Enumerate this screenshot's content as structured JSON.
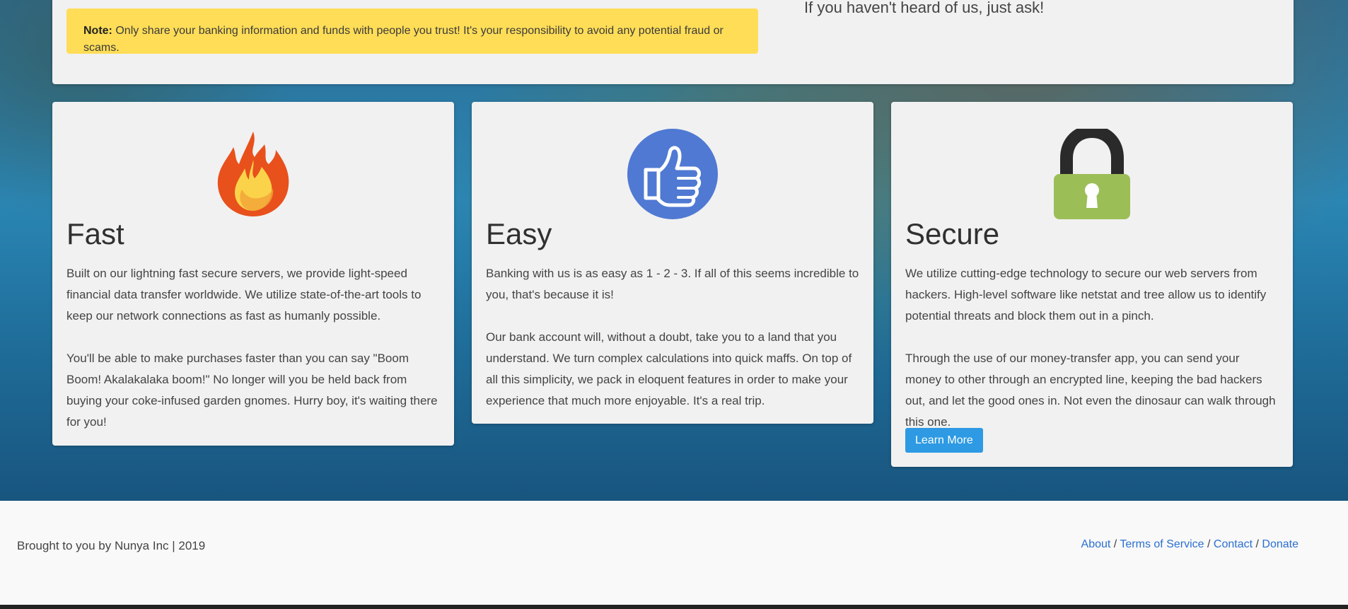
{
  "notice": {
    "label": "Note:",
    "text": "Only share your banking information and funds with people you trust! It's your responsibility to avoid any potential fraud or scams."
  },
  "top_right_text": "If you haven't heard of us, just ask!",
  "cards": [
    {
      "title": "Fast",
      "icon": "fire-icon",
      "paragraphs": [
        "Built on our lightning fast secure servers, we provide light-speed financial data transfer worldwide. We utilize state-of-the-art tools to keep our network connections as fast as humanly possible.",
        "You'll be able to make purchases faster than you can say \"Boom Boom! Akalakalaka boom!\" No longer will you be held back from buying your coke-infused garden gnomes. Hurry boy, it's waiting there for you!"
      ]
    },
    {
      "title": "Easy",
      "icon": "thumbs-up-icon",
      "paragraphs": [
        "Banking with us is as easy as 1 - 2 - 3. If all of this seems incredible to you, that's because it is!",
        "Our bank account will, without a doubt, take you to a land that you understand. We turn complex calculations into quick maffs. On top of all this simplicity, we pack in eloquent features in order to make your experience that much more enjoyable. It's a real trip."
      ]
    },
    {
      "title": "Secure",
      "icon": "padlock-icon",
      "paragraphs": [
        "We utilize cutting-edge technology to secure our web servers from hackers. High-level software like netstat and tree allow us to identify potential threats and block them out in a pinch.",
        "Through the use of our money-transfer app, you can send your money to other through an encrypted line, keeping the bad hackers out, and let the good ones in. Not even the dinosaur can walk through this one."
      ],
      "button_label": "Learn More"
    }
  ],
  "footer": {
    "credit": "Brought to you by Nunya Inc | 2019",
    "links": [
      "About",
      "Terms of Service",
      "Contact",
      "Donate"
    ],
    "separator": "/"
  },
  "colors": {
    "note_bg": "#ffdd57",
    "button_bg": "#2d9ae3",
    "link": "#2b6fcf",
    "fire_outer": "#e8501c",
    "fire_inner": "#fbd34a",
    "thumb_bg": "#4f79d3",
    "lock_body": "#9cbe57",
    "lock_shackle": "#2a2a2a"
  }
}
